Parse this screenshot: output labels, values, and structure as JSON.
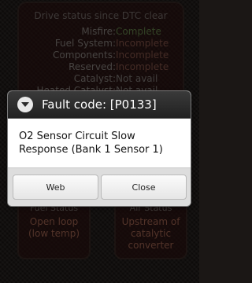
{
  "status_panel": {
    "title": "Drive status since DTC clear",
    "rows": [
      {
        "label": "Misfire:",
        "value": "Complete",
        "state": "ok"
      },
      {
        "label": "Fuel System:",
        "value": "Incomplete",
        "state": "bad"
      },
      {
        "label": "Components:",
        "value": "Incomplete",
        "state": "bad"
      },
      {
        "label": "Reserved:",
        "value": "Incomplete",
        "state": "bad"
      },
      {
        "label": "Catalyst:",
        "value": "Not avail",
        "state": "na"
      },
      {
        "label": "Heated Catalyst:",
        "value": "Not avail",
        "state": "na"
      }
    ]
  },
  "tiles": {
    "fuel_status": {
      "title": "Fuel Status",
      "value_line1": "Open loop",
      "value_line2": "(low temp)"
    },
    "air_status": {
      "title": "Air Status",
      "value_line1": "Upstream of",
      "value_line2": "catalytic",
      "value_line3": "converter"
    }
  },
  "dialog": {
    "title": "Fault code: [P0133]",
    "message": "O2 Sensor Circuit Slow Response (Bank 1 Sensor 1)",
    "web_label": "Web",
    "close_label": "Close",
    "icon": "chevron-down-icon"
  }
}
